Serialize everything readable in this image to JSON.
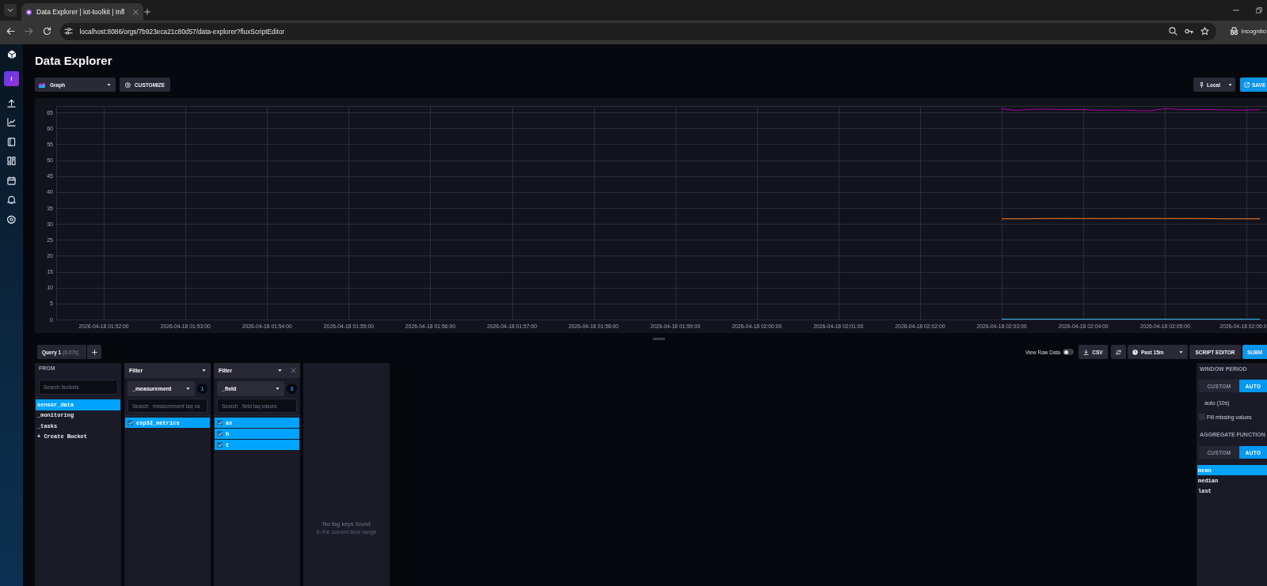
{
  "browser": {
    "tabs": [
      {
        "title": "Data Explorer | iot-toolkit | Infl",
        "selected": true
      }
    ],
    "address": "localhost:8086/orgs/7b923eca21c80d57/data-explorer?fluxScriptEditor",
    "profile": "Incognito"
  },
  "nav": {
    "avatar": "I"
  },
  "header": {
    "title": "Data Explorer",
    "view_type": "Graph",
    "customize": "CUSTOMIZE",
    "timezone": "Local",
    "save": "SAVE"
  },
  "graph": {
    "chart_data": {
      "type": "line",
      "grid": true,
      "categories": [
        null,
        null,
        null,
        "2026-04-18 01:52:00",
        null,
        null,
        null,
        null,
        null,
        "2026-04-18 01:53:00",
        null,
        null,
        null,
        null,
        null,
        "2026-04-18 01:54:00",
        null,
        null,
        null,
        null,
        null,
        "2026-04-18 01:55:00",
        null,
        null,
        null,
        null,
        null,
        "2026-04-18 01:56:00",
        null,
        null,
        null,
        null,
        null,
        "2026-04-18 01:57:00",
        null,
        null,
        null,
        null,
        null,
        "2026-04-18 01:58:00",
        null,
        null,
        null,
        null,
        null,
        "2026-04-18 01:59:00",
        null,
        null,
        null,
        null,
        null,
        "2026-04-18 02:00:00",
        null,
        null,
        null,
        null,
        null,
        "2026-04-18 02:01:00",
        null,
        null,
        null,
        null,
        null,
        "2026-04-18 02:02:00",
        null,
        null,
        null,
        null,
        null,
        "2026-04-18 02:03:00",
        null,
        null,
        null,
        null,
        null,
        "2026-04-18 02:04:00",
        null,
        null,
        null,
        null,
        null,
        "2026-04-18 02:05:00",
        null,
        null,
        null,
        null,
        null,
        "2026-04-18 02:06:0",
        null
      ],
      "ylim": [
        0,
        67
      ],
      "yticks": [
        0,
        5,
        10,
        15,
        20,
        25,
        30,
        35,
        40,
        45,
        50,
        55,
        60,
        65
      ],
      "series": [
        {
          "color": "#31c0f6",
          "values": [
            null,
            null,
            null,
            null,
            null,
            null,
            null,
            null,
            null,
            null,
            null,
            null,
            null,
            null,
            null,
            null,
            null,
            null,
            null,
            null,
            null,
            null,
            null,
            null,
            null,
            null,
            null,
            null,
            null,
            null,
            null,
            null,
            null,
            null,
            null,
            null,
            null,
            null,
            null,
            null,
            null,
            null,
            null,
            null,
            null,
            null,
            null,
            null,
            null,
            null,
            null,
            null,
            null,
            null,
            null,
            null,
            null,
            null,
            null,
            null,
            null,
            null,
            null,
            null,
            null,
            null,
            null,
            null,
            null,
            0.1,
            0.1,
            0.1,
            0.1,
            0.1,
            0.1,
            0.1,
            0.1,
            0.1,
            0.1,
            0.1,
            0.1,
            0.1,
            0.1,
            0.1,
            0.1,
            0.1,
            0.1,
            0.1,
            0.1
          ]
        },
        {
          "color": "#a500a5",
          "values": [
            null,
            null,
            null,
            null,
            null,
            null,
            null,
            null,
            null,
            null,
            null,
            null,
            null,
            null,
            null,
            null,
            null,
            null,
            null,
            null,
            null,
            null,
            null,
            null,
            null,
            null,
            null,
            null,
            null,
            null,
            null,
            null,
            null,
            null,
            null,
            null,
            null,
            null,
            null,
            null,
            null,
            null,
            null,
            null,
            null,
            null,
            null,
            null,
            null,
            null,
            null,
            null,
            null,
            null,
            null,
            null,
            null,
            null,
            null,
            null,
            null,
            null,
            null,
            null,
            null,
            null,
            null,
            null,
            null,
            66.1,
            65.6,
            65.9,
            66.0,
            65.9,
            65.8,
            65.9,
            65.6,
            65.7,
            65.7,
            65.5,
            65.5,
            66.2,
            65.9,
            65.8,
            65.9,
            65.8,
            65.7,
            65.7,
            65.8
          ]
        },
        {
          "color": "#ff7e27",
          "values": [
            null,
            null,
            null,
            null,
            null,
            null,
            null,
            null,
            null,
            null,
            null,
            null,
            null,
            null,
            null,
            null,
            null,
            null,
            null,
            null,
            null,
            null,
            null,
            null,
            null,
            null,
            null,
            null,
            null,
            null,
            null,
            null,
            null,
            null,
            null,
            null,
            null,
            null,
            null,
            null,
            null,
            null,
            null,
            null,
            null,
            null,
            null,
            null,
            null,
            null,
            null,
            null,
            null,
            null,
            null,
            null,
            null,
            null,
            null,
            null,
            null,
            null,
            null,
            null,
            null,
            null,
            null,
            null,
            null,
            31.6,
            31.6,
            31.6,
            31.7,
            31.7,
            31.7,
            31.7,
            31.7,
            31.7,
            31.7,
            31.7,
            31.7,
            31.7,
            31.7,
            31.7,
            31.7,
            31.6,
            31.6,
            31.6,
            31.6
          ]
        }
      ]
    }
  },
  "query_tabs": [
    {
      "label": "Query 1",
      "duration": "(0.07s)",
      "selected": true
    }
  ],
  "query_actions": {
    "raw_data": {
      "label": "View Raw Data",
      "on": false
    },
    "csv": "CSV",
    "time_range": "Past 15m",
    "script_editor": "SCRIPT EDITOR",
    "submit": "SUBM"
  },
  "from": {
    "title": "FROM",
    "search": {
      "placeholder": "Search buckets"
    },
    "buckets": [
      {
        "name": "sensor_data",
        "selected": true
      },
      {
        "name": "_monitoring",
        "selected": false
      },
      {
        "name": "_tasks",
        "selected": false
      }
    ],
    "create": "+ Create Bucket"
  },
  "filters": [
    {
      "title": "Filter",
      "key": "_measurement",
      "count": "1",
      "removable": false,
      "search": {
        "placeholder": "Search _measurement tag va"
      },
      "values": [
        {
          "name": "esp32_metrics",
          "checked": true
        }
      ]
    },
    {
      "title": "Filter",
      "key": "_field",
      "count": "3",
      "removable": true,
      "search": {
        "placeholder": "Search _field tag values"
      },
      "values": [
        {
          "name": "ax",
          "checked": true
        },
        {
          "name": "h",
          "checked": true
        },
        {
          "name": "t",
          "checked": true
        }
      ]
    }
  ],
  "empty_filter": {
    "message": "No tag keys found",
    "detail": "in the current time range"
  },
  "window_period": {
    "title": "WINDOW PERIOD",
    "modes": [
      {
        "label": "CUSTOM",
        "selected": false
      },
      {
        "label": "AUTO",
        "selected": true
      }
    ],
    "value": "auto (10s)",
    "fill_missing": {
      "label": "Fill missing values",
      "checked": false
    }
  },
  "aggregate": {
    "title": "AGGREGATE FUNCTION",
    "modes": [
      {
        "label": "CUSTOM",
        "selected": false
      },
      {
        "label": "AUTO",
        "selected": true
      }
    ],
    "functions": [
      {
        "name": "mean",
        "selected": true
      },
      {
        "name": "median",
        "selected": false
      },
      {
        "name": "last",
        "selected": false
      }
    ]
  }
}
